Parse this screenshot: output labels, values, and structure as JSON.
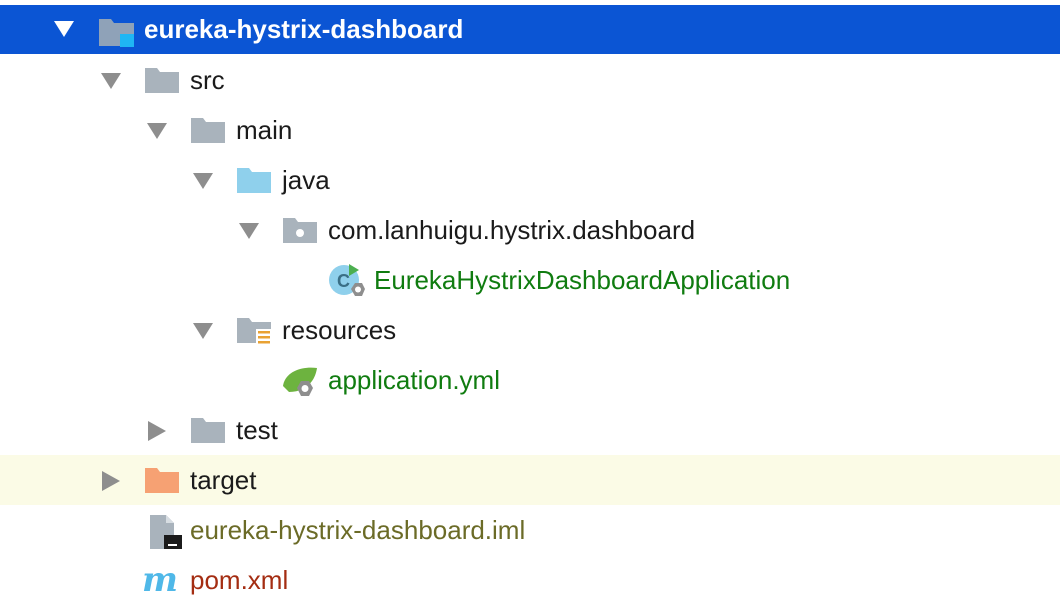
{
  "project_tree": {
    "root": {
      "label": "eureka-hystrix-dashboard",
      "icon": "module-folder-icon",
      "expanded": true,
      "selected": true
    },
    "items": [
      {
        "label": "src",
        "icon": "folder-icon",
        "expanded": true
      },
      {
        "label": "main",
        "icon": "folder-icon",
        "expanded": true
      },
      {
        "label": "java",
        "icon": "source-folder-icon",
        "expanded": true
      },
      {
        "label": "com.lanhuigu.hystrix.dashboard",
        "icon": "package-icon",
        "expanded": true
      },
      {
        "label": "EurekaHystrixDashboardApplication",
        "icon": "spring-boot-class-icon"
      },
      {
        "label": "resources",
        "icon": "resources-folder-icon",
        "expanded": true
      },
      {
        "label": "application.yml",
        "icon": "spring-config-file-icon"
      },
      {
        "label": "test",
        "icon": "folder-icon",
        "expanded": false
      },
      {
        "label": "target",
        "icon": "excluded-folder-icon",
        "expanded": false,
        "highlighted": true
      },
      {
        "label": "eureka-hystrix-dashboard.iml",
        "icon": "iml-file-icon"
      },
      {
        "label": "pom.xml",
        "icon": "maven-icon"
      }
    ]
  },
  "colors": {
    "selection": "#0b55d4",
    "highlight_row": "#fbfbe6",
    "folder_gray": "#a9b3bc",
    "source_folder": "#8fd0ec",
    "excluded_folder": "#f6a173",
    "spring_green": "#107c10",
    "iml_text": "#6b6b27",
    "pom_text": "#a42d12",
    "maven_blue": "#4fb8e8"
  }
}
